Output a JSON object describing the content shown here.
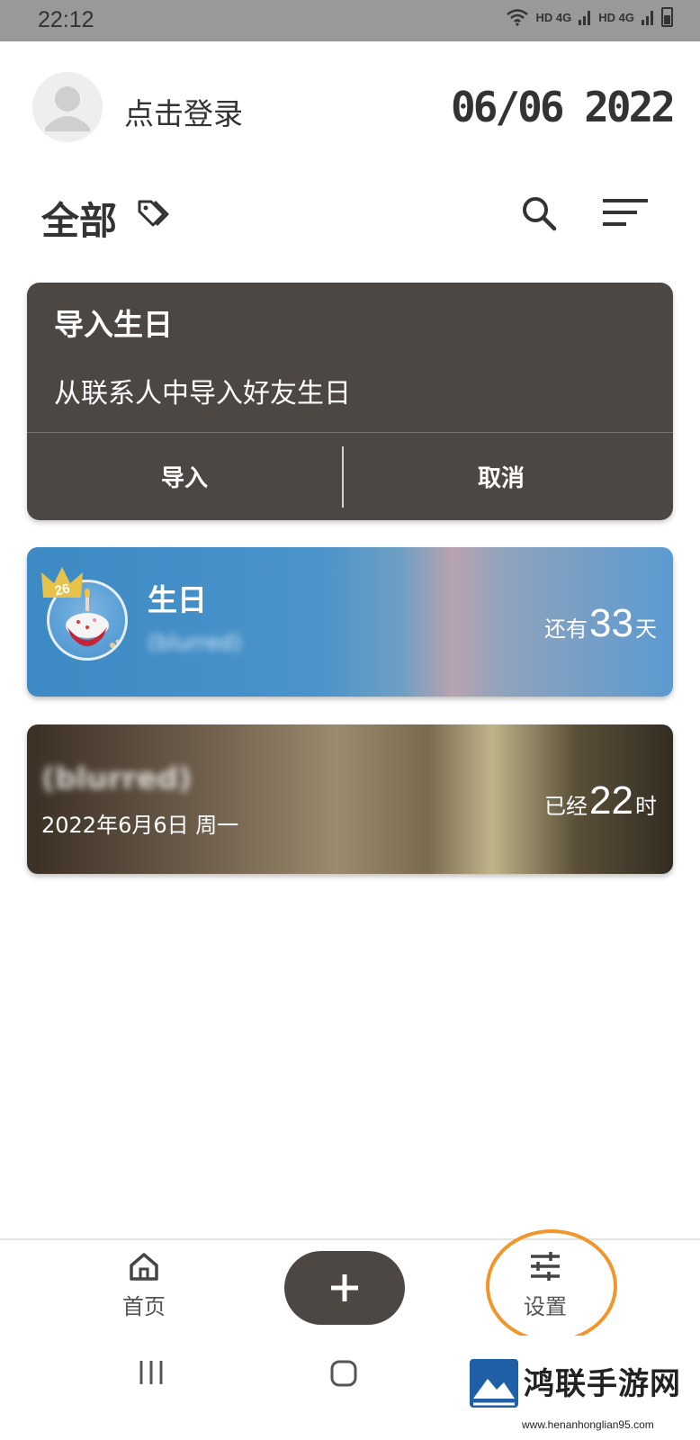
{
  "status_bar": {
    "time": "22:12",
    "network_1": "HD 4G",
    "network_2": "HD 4G"
  },
  "header": {
    "login_label": "点击登录",
    "date": "06/06 2022"
  },
  "toolbar": {
    "title": "全部",
    "tag_icon": "tag-icon",
    "search_icon": "search-icon",
    "sort_icon": "sort-lines-icon"
  },
  "import_card": {
    "title": "导入生日",
    "description": "从联系人中导入好友生日",
    "import_label": "导入",
    "cancel_label": "取消"
  },
  "events": [
    {
      "type": "birthday",
      "age_badge": "26",
      "title": "生日",
      "subtitle": "(blurred)",
      "count_prefix": "还有",
      "count_value": "33",
      "count_unit": "天",
      "color": "#4a93cb"
    },
    {
      "type": "anniversary",
      "title": "(blurred)",
      "subtitle": "2022年6月6日 周一",
      "count_prefix": "已经",
      "count_value": "22",
      "count_unit": "时",
      "color": "#6a5a48"
    }
  ],
  "bottom_nav": {
    "home_label": "首页",
    "settings_label": "设置",
    "add_icon": "plus-icon",
    "highlight_color": "#f0962a"
  },
  "watermark": {
    "text": "鸿联手游网",
    "url": "www.henanhonglian95.com"
  },
  "colors": {
    "dark_card": "#4d4744",
    "status_bar": "#999999"
  }
}
